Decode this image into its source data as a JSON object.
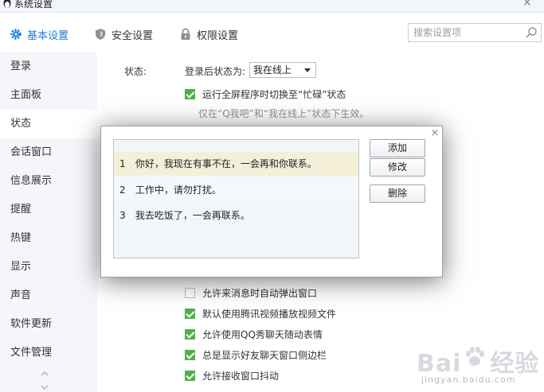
{
  "window": {
    "title": "系统设置",
    "close_glyph": "×"
  },
  "toolbar": {
    "tabs": [
      {
        "label": "基本设置",
        "icon": "gear-icon",
        "active": true
      },
      {
        "label": "安全设置",
        "icon": "shield-icon",
        "active": false
      },
      {
        "label": "权限设置",
        "icon": "lock-icon",
        "active": false
      }
    ],
    "search": {
      "placeholder": "搜索设置项",
      "icon": "search-icon"
    }
  },
  "sidebar": {
    "items": [
      {
        "label": "登录"
      },
      {
        "label": "主面板"
      },
      {
        "label": "状态",
        "selected": true
      },
      {
        "label": "会话窗口"
      },
      {
        "label": "信息展示"
      },
      {
        "label": "提醒"
      },
      {
        "label": "热键"
      },
      {
        "label": "显示"
      },
      {
        "label": "声音"
      },
      {
        "label": "软件更新"
      },
      {
        "label": "文件管理"
      }
    ]
  },
  "main": {
    "status_label": "状态:",
    "after_login_label": "登录后状态为:",
    "status_value": "我在线上",
    "busy_option": {
      "label": "运行全屏程序时切换至“忙碌”状态",
      "checked": true
    },
    "busy_hint": "仅在“Q我吧”和“我在线上”状态下生效。",
    "options": [
      {
        "label": "允许来消息时自动弹出窗口",
        "checked": false
      },
      {
        "label": "默认使用腾讯视频播放视频文件",
        "checked": true
      },
      {
        "label": "允许使用QQ秀聊天随动表情",
        "checked": true
      },
      {
        "label": "总是显示好友聊天窗口侧边栏",
        "checked": true
      },
      {
        "label": "允许接收窗口抖动",
        "checked": true
      }
    ]
  },
  "dialog": {
    "close_glyph": "×",
    "messages": [
      {
        "num": "1",
        "text": "你好，我现在有事不在，一会再和你联系。",
        "selected": true
      },
      {
        "num": "2",
        "text": "工作中，请勿打扰。",
        "selected": false
      },
      {
        "num": "3",
        "text": "我去吃饭了，一会再联系。",
        "selected": false
      }
    ],
    "buttons": {
      "add": "添加",
      "edit": "修改",
      "delete": "删除"
    }
  },
  "watermark": {
    "text": "Bai",
    "text2": "经验",
    "sub": "jingyan.baidu.com"
  },
  "colors": {
    "accent": "#1f7bd6",
    "check": "#4fb04a",
    "selected_row": "#f4efd9"
  }
}
